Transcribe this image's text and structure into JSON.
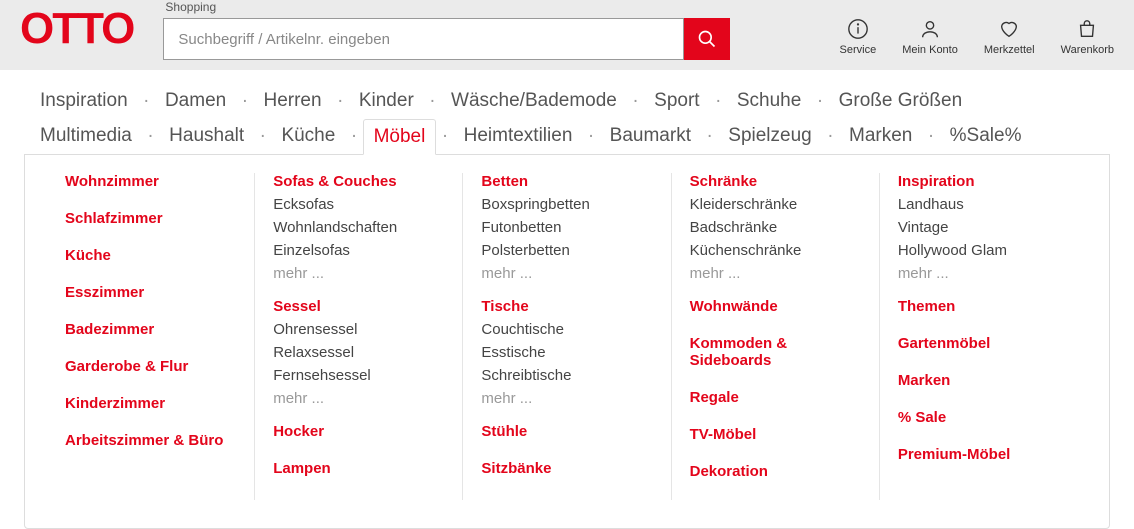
{
  "logo": "OTTO",
  "header": {
    "shopping_label": "Shopping",
    "search_placeholder": "Suchbegriff / Artikelnr. eingeben",
    "icons": [
      {
        "name": "service-icon",
        "label": "Service"
      },
      {
        "name": "account-icon",
        "label": "Mein Konto"
      },
      {
        "name": "wishlist-icon",
        "label": "Merkzettel"
      },
      {
        "name": "cart-icon",
        "label": "Warenkorb"
      }
    ]
  },
  "nav": {
    "row1": [
      "Inspiration",
      "Damen",
      "Herren",
      "Kinder",
      "Wäsche/Bademode",
      "Sport",
      "Schuhe",
      "Große Größen"
    ],
    "row2": [
      "Multimedia",
      "Haushalt",
      "Küche",
      "Möbel",
      "Heimtextilien",
      "Baumarkt",
      "Spielzeug",
      "Marken",
      "%Sale%"
    ],
    "active": "Möbel",
    "sep": "."
  },
  "mega": {
    "more_label": "mehr ...",
    "cols": [
      [
        {
          "head": "Wohnzimmer"
        },
        {
          "head": "Schlafzimmer"
        },
        {
          "head": "Küche"
        },
        {
          "head": "Esszimmer"
        },
        {
          "head": "Badezimmer"
        },
        {
          "head": "Garderobe & Flur"
        },
        {
          "head": "Kinderzimmer"
        },
        {
          "head": "Arbeitszimmer & Büro"
        }
      ],
      [
        {
          "head": "Sofas & Couches",
          "items": [
            "Ecksofas",
            "Wohnlandschaften",
            "Einzelsofas"
          ],
          "more": true
        },
        {
          "head": "Sessel",
          "items": [
            "Ohrensessel",
            "Relaxsessel",
            "Fernsehsessel"
          ],
          "more": true
        },
        {
          "head": "Hocker"
        },
        {
          "head": "Lampen"
        }
      ],
      [
        {
          "head": "Betten",
          "items": [
            "Boxspringbetten",
            "Futonbetten",
            "Polsterbetten"
          ],
          "more": true
        },
        {
          "head": "Tische",
          "items": [
            "Couchtische",
            "Esstische",
            "Schreibtische"
          ],
          "more": true
        },
        {
          "head": "Stühle"
        },
        {
          "head": "Sitzbänke"
        }
      ],
      [
        {
          "head": "Schränke",
          "items": [
            "Kleiderschränke",
            "Badschränke",
            "Küchenschränke"
          ],
          "more": true
        },
        {
          "head": "Wohnwände"
        },
        {
          "head": "Kommoden & Sideboards"
        },
        {
          "head": "Regale"
        },
        {
          "head": "TV-Möbel"
        },
        {
          "head": "Dekoration"
        }
      ],
      [
        {
          "head": "Inspiration",
          "items": [
            "Landhaus",
            "Vintage",
            "Hollywood Glam"
          ],
          "more": true
        },
        {
          "head": "Themen"
        },
        {
          "head": "Gartenmöbel"
        },
        {
          "head": "Marken"
        },
        {
          "head": "% Sale"
        },
        {
          "head": "Premium-Möbel"
        }
      ]
    ]
  }
}
